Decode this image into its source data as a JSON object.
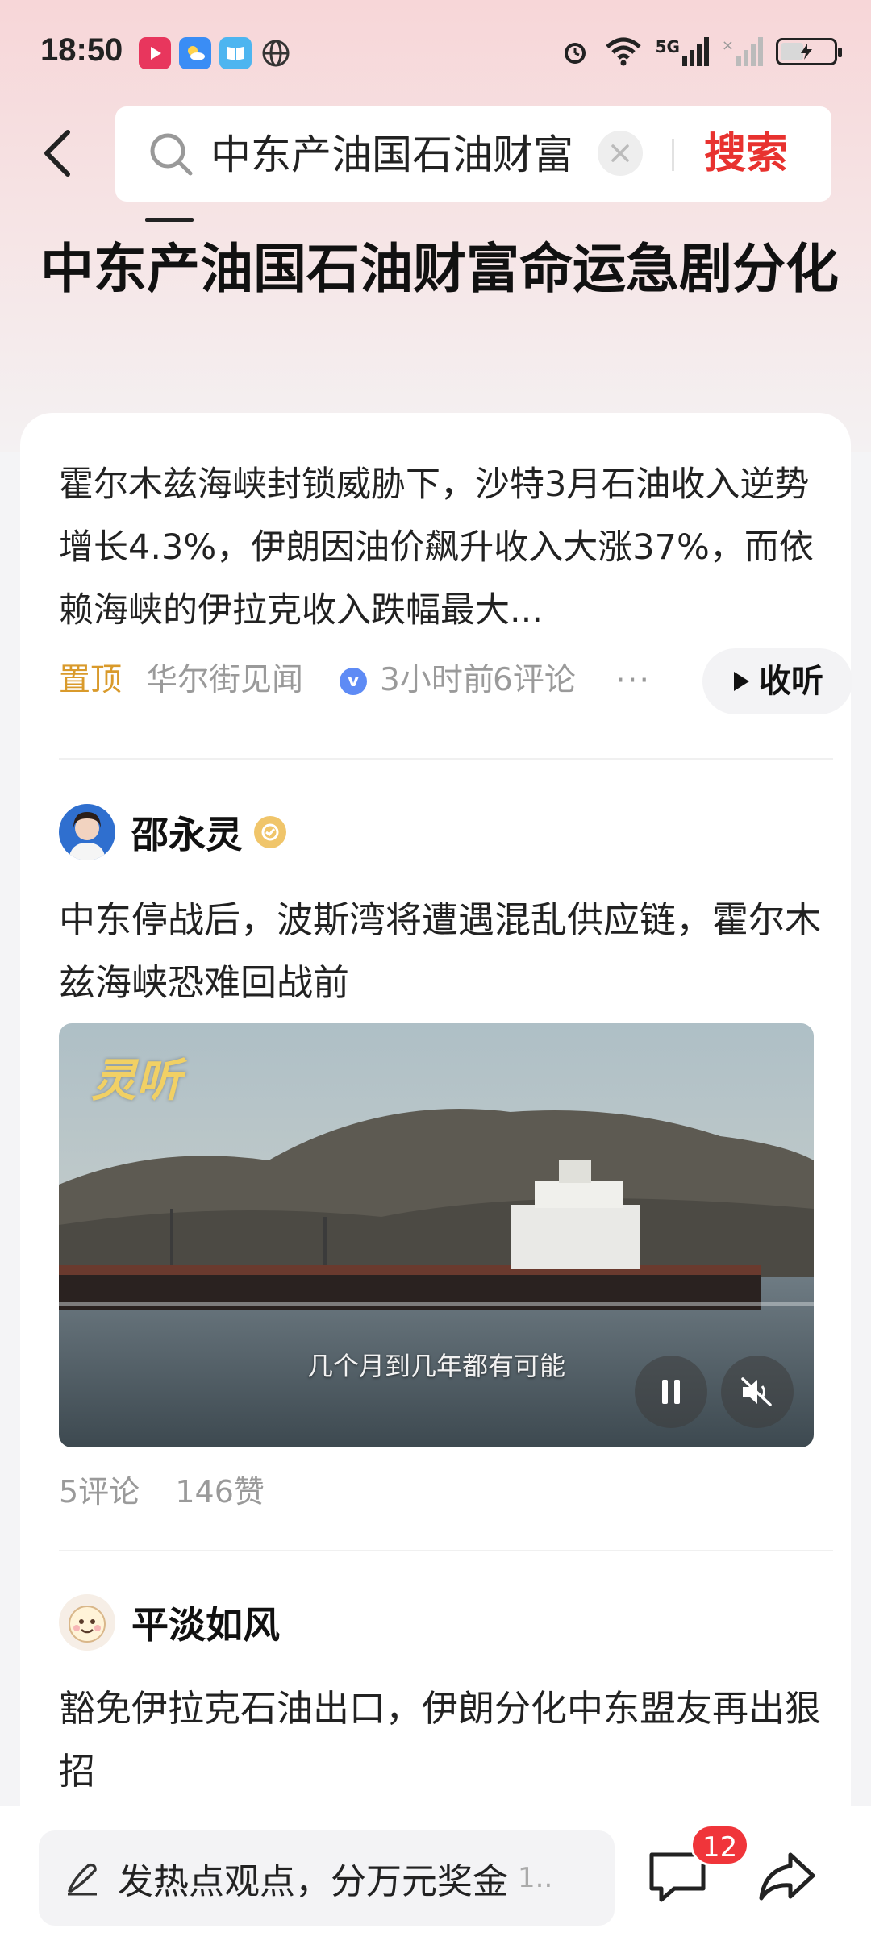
{
  "status_bar": {
    "time": "18:50",
    "network": "5G",
    "icons": [
      "video-app-icon",
      "weather-app-icon",
      "book-app-icon",
      "globe-app-icon",
      "alarm-icon",
      "wifi-icon",
      "signal-5g-icon",
      "signal-icon",
      "battery-icon"
    ]
  },
  "search": {
    "query": "中东产油国石油财富",
    "button_label": "搜索"
  },
  "page": {
    "title": "中东产油国石油财富命运急剧分化"
  },
  "summary": {
    "text": "霍尔木兹海峡封锁威胁下，沙特3月石油收入逆势增长4.3%，伊朗因油价飙升收入大涨37%，而依赖海峡的伊拉克收入跌幅最大...",
    "pinned_label": "置顶",
    "source": "华尔街见闻",
    "verified_mark": "v",
    "time": "3小时前",
    "comments": "6评论",
    "more": "···",
    "listen_label": "收听"
  },
  "posts": [
    {
      "author": "邵永灵",
      "text": "中东停战后，波斯湾将遭遇混乱供应链，霍尔木兹海峡恐难回战前",
      "video": {
        "brand_text": "灵听",
        "subtitle": "几个月到几年都有可能"
      },
      "comments": "5评论",
      "likes": "146赞"
    },
    {
      "author": "平淡如风",
      "text": "豁免伊拉克石油出口，伊朗分化中东盟友再出狠招"
    }
  ],
  "bottom_bar": {
    "comment_placeholder": "发热点观点，分万元奖金",
    "comment_tail": "1..",
    "notification_count": "12"
  },
  "colors": {
    "accent_red": "#e8322f",
    "pinned_gold": "#d99a2b",
    "badge_red": "#f0353a"
  }
}
